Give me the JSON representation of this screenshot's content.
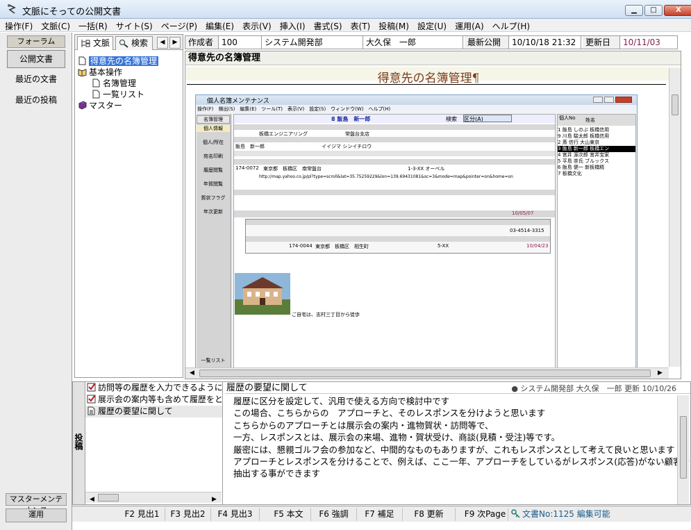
{
  "window": {
    "title": "文脈にそっての公開文書",
    "min_label": "▁",
    "max_label": "□",
    "close_label": "X"
  },
  "menu": [
    "操作(F)",
    "文脈(C)",
    "一括(R)",
    "サイト(S)",
    "ページ(P)",
    "編集(E)",
    "表示(V)",
    "挿入(I)",
    "書式(S)",
    "表(T)",
    "投稿(M)",
    "設定(U)",
    "運用(A)",
    "ヘルプ(H)"
  ],
  "left": {
    "header": "フォーラム",
    "items": [
      "公開文書",
      "最近の文書",
      "最近の投稿"
    ],
    "bottom1": "マスターメンテナンス",
    "bottom2": "運用"
  },
  "tabs": {
    "context": "文脈",
    "search": "検索"
  },
  "tree": {
    "root": "得意先の名簿管理",
    "folder": "基本操作",
    "child1": "名簿管理",
    "child2": "一覧リスト",
    "master": "マスター"
  },
  "info": {
    "author_label": "作成者",
    "author_id": "100",
    "dept": "システム開発部",
    "name": "大久保　一郎",
    "latest_label": "最新公開",
    "latest_value": "10/10/18 21:32",
    "updated_label": "更新日",
    "updated_value": "10/11/03"
  },
  "doc": {
    "heading": "得意先の名簿管理",
    "title": "得意先の名簿管理¶",
    "caption": "ご自宅は、志村三丁目から徒歩",
    "screenshot": {
      "title": "個人名簿メンテナンス",
      "menu": "操作(F)　検出(S)　編集(E)　ツール(T)　表示(V)　設定(S)　ウィンドウ(W)　ヘルプ(H)",
      "nav": [
        "名簿管理",
        "個人情報",
        "個人/所在",
        "宛名印刷",
        "履歴閲覧",
        "年賀閲覧",
        "賀状フラグ",
        "年次更新"
      ],
      "nav_bottom": "一覧リスト",
      "header_name": "8 飯島　新一郎",
      "search_label": "検索",
      "search_value": "区分(A)",
      "company": "板橋エンジニアリング",
      "branch": "常盤台支店",
      "person": "飯島　新一郎",
      "kana": "イイジマ シンイチロウ",
      "postal": "174-0072",
      "address": "東京都　板橋区　南常盤台",
      "block": "1-3-XX オーベル",
      "url": "http://map.yahoo.co.jp/pl?type=scroll&lat=35.75259229&lon=139.69431081&sc=3&mode=map&pointer=on&home=on",
      "memo_date": "10/05/07",
      "phone": "03-4514-3315",
      "hist_postal": "174-0044",
      "hist_addr": "東京都　板橋区　相生町",
      "hist_block": "5-XX",
      "hist_date": "10/04/23",
      "list_head": [
        "個人No",
        "姓名"
      ],
      "list": [
        [
          "1",
          "飯島 しのぶ",
          "板橋信用"
        ],
        [
          "9",
          "川島 駿太郎",
          "板橋信用"
        ],
        [
          "2",
          "斎 信行",
          "大山東京"
        ],
        [
          "3",
          "飯島 新一郎",
          "板橋エン"
        ],
        [
          "4",
          "宮井 源次郎",
          "宮井宝家"
        ],
        [
          "5",
          "平島 崇氏",
          "ブルックス"
        ],
        [
          "6",
          "飯島 健一",
          "新板橋精"
        ],
        [
          "7",
          "",
          "板橋文化"
        ]
      ]
    }
  },
  "posts": {
    "panel_label": "投稿",
    "items": [
      "訪問等の履歴を入力できるようにな",
      "展示会の案内等も含めて履歴をと",
      "履歴の要望に関して"
    ],
    "subject": "履歴の要望に関して",
    "meta": "● システム開発部 大久保　一郎 更新 10/10/26",
    "lines": [
      "履歴に区分を設定して、汎用で使える方向で検討中です",
      "この場合、こちらからの　アプローチと、そのレスポンスを分けようと思います",
      "こちらからのアプローチとは展示会の案内・進物賀状・訪問等で、",
      "一方、レスポンスとは、展示会の来場、進物・賀状受け、商談(見積・受注)等です。",
      "厳密には、懇親ゴルフ会の参加など、中間的なものもありますが、これもレスポンスとして考えて良いと思います",
      "アプローチとレスポンスを分けることで、例えば、ここ一年、アプローチをしているがレスポンス(応答)がない顧客を",
      "抽出する事ができます"
    ]
  },
  "fkeys": [
    "F2 見出1",
    "F3 見出2",
    "F4 見出3",
    "F5 本文",
    "F6 強調",
    "F7 補足",
    "F8 更新",
    "F9 次Page"
  ],
  "status": "文書No:1125 編集可能"
}
